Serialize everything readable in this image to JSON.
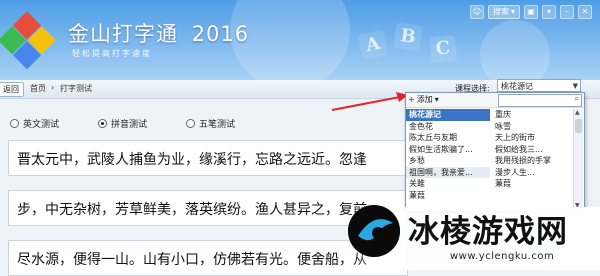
{
  "app": {
    "title": "金山打字通",
    "version": "2016",
    "slogan": "轻松提高打字速度"
  },
  "topbar": {
    "search_label": "搜索",
    "buttons": [
      "▾",
      "–",
      "✕"
    ]
  },
  "nav": {
    "back_label": "返回",
    "breadcrumb_home": "首页",
    "breadcrumb_sep": "›",
    "breadcrumb_current": "打字测试",
    "course_label": "课程选择:",
    "course_value": "桃花源记"
  },
  "modes": [
    {
      "label": "英文测试",
      "selected": false
    },
    {
      "label": "拼音测试",
      "selected": true
    },
    {
      "label": "五笔测试",
      "selected": false
    }
  ],
  "text_lines": [
    "晋太元中，武陵人捕鱼为业，缘溪行，忘路之远近。忽逢",
    "步，中无杂树，芳草鲜美，落英缤纷。渔人甚异之，复前",
    "尽水源，便得一山。山有小口，仿佛若有光。便舍船，从"
  ],
  "dropdown": {
    "add_label": "添加",
    "search_placeholder": "",
    "left_items": [
      {
        "label": "桃花源记",
        "state": "selected"
      },
      {
        "label": "金色花",
        "state": ""
      },
      {
        "label": "陈太丘与友期",
        "state": ""
      },
      {
        "label": "假如生活欺骗了...",
        "state": ""
      },
      {
        "label": "乡愁",
        "state": ""
      },
      {
        "label": "祖国啊，我亲爱...",
        "state": "highlight"
      },
      {
        "label": "关雎",
        "state": ""
      },
      {
        "label": "蒹葭",
        "state": ""
      }
    ],
    "right_items": [
      {
        "label": "重庆"
      },
      {
        "label": "咏雪"
      },
      {
        "label": "天上的街市"
      },
      {
        "label": "假如给我三..."
      },
      {
        "label": "我用残损的手掌"
      },
      {
        "label": "漫步人生..."
      },
      {
        "label": "蒹葭"
      }
    ]
  },
  "decor": {
    "abc": [
      "A",
      "B",
      "C"
    ]
  },
  "watermark": {
    "title": "冰棱游戏网",
    "url": "www.yclengku.com"
  }
}
